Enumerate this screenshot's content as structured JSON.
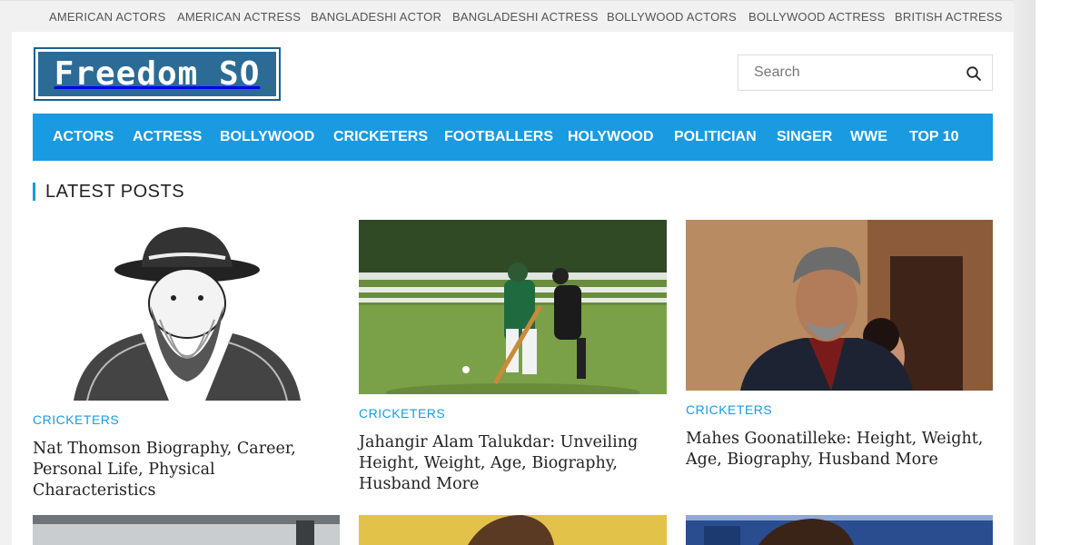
{
  "topbar": {
    "links": [
      "AMERICAN ACTORS",
      "AMERICAN ACTRESS",
      "BANGLADESHI ACTOR",
      "BANGLADESHI ACTRESS",
      "BOLLYWOOD ACTORS",
      "BOLLYWOOD ACTRESS",
      "BRITISH ACTRESS"
    ]
  },
  "header": {
    "logo_text": "Freedom SO",
    "search_placeholder": "Search"
  },
  "nav": {
    "items": [
      "ACTORS",
      "ACTRESS",
      "BOLLYWOOD",
      "CRICKETERS",
      "FOOTBALLERS",
      "HOLYWOOD",
      "POLITICIAN",
      "SINGER",
      "WWE",
      "TOP 10"
    ]
  },
  "section": {
    "title": "LATEST POSTS"
  },
  "posts": [
    {
      "category": "CRICKETERS",
      "title": "Nat Thomson Biography, Career, Personal Life, Physical Characteristics"
    },
    {
      "category": "CRICKETERS",
      "title": "Jahangir Alam Talukdar: Unveiling Height, Weight, Age, Biography, Husband More"
    },
    {
      "category": "CRICKETERS",
      "title": "Mahes Goonatilleke: Height, Weight, Age, Biography, Husband More"
    }
  ],
  "colors": {
    "accent": "#1a9ae0",
    "logo_bg": "#2c6b96"
  },
  "icons": {
    "search": "search-icon"
  }
}
